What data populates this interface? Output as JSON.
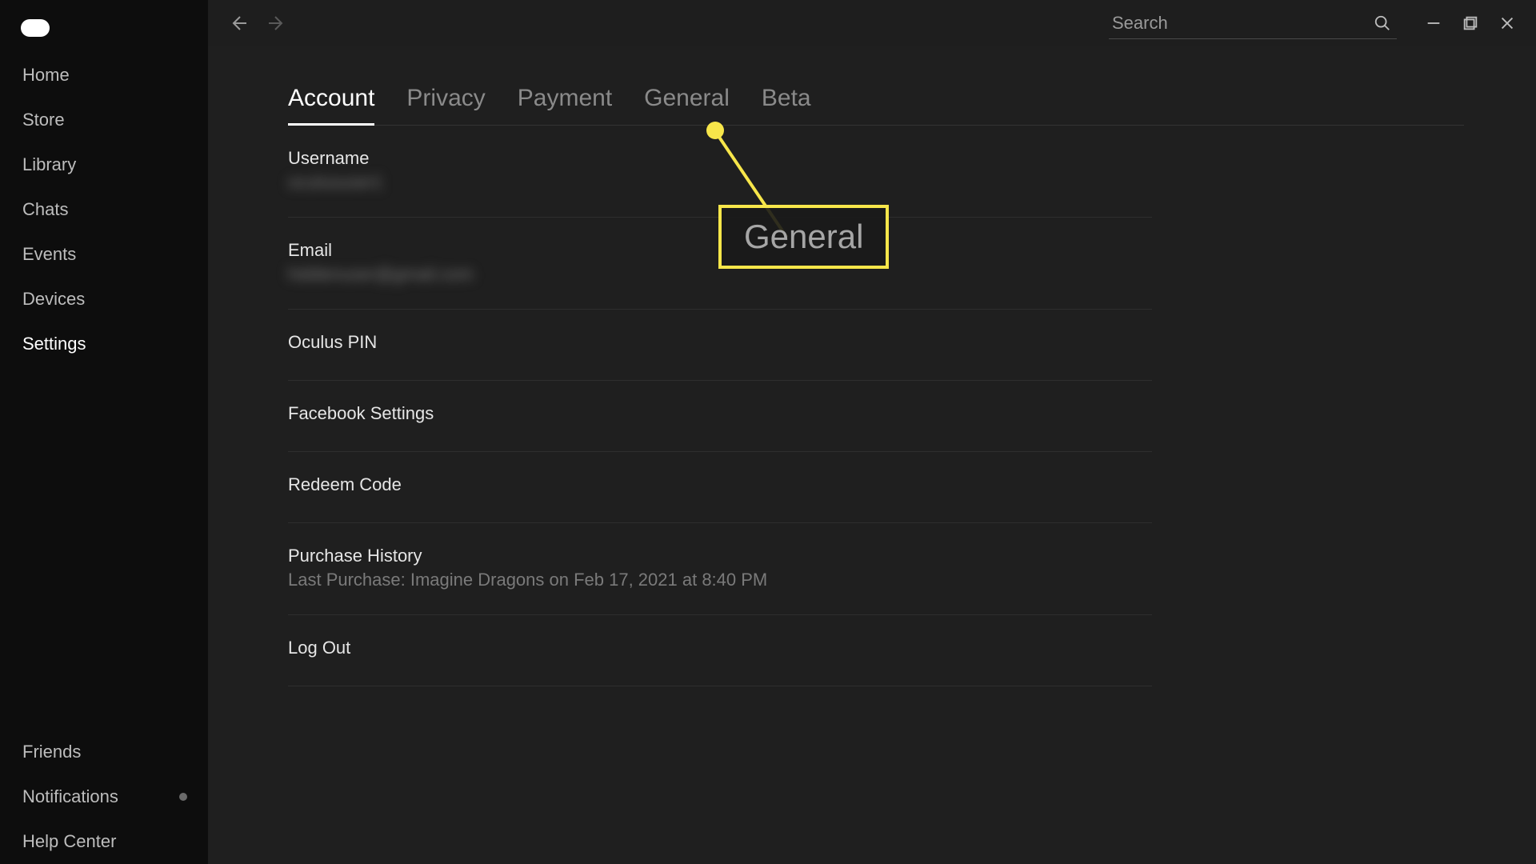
{
  "sidebar": {
    "items": [
      {
        "label": "Home"
      },
      {
        "label": "Store"
      },
      {
        "label": "Library"
      },
      {
        "label": "Chats"
      },
      {
        "label": "Events"
      },
      {
        "label": "Devices"
      },
      {
        "label": "Settings"
      }
    ],
    "bottom": [
      {
        "label": "Friends"
      },
      {
        "label": "Notifications"
      },
      {
        "label": "Help Center"
      }
    ]
  },
  "topbar": {
    "search_placeholder": "Search"
  },
  "tabs": [
    {
      "label": "Account"
    },
    {
      "label": "Privacy"
    },
    {
      "label": "Payment"
    },
    {
      "label": "General"
    },
    {
      "label": "Beta"
    }
  ],
  "account": {
    "username_label": "Username",
    "username_value": "oculususer1",
    "email_label": "Email",
    "email_value": "hiddenuser@gmail.com",
    "pin_label": "Oculus PIN",
    "facebook_label": "Facebook Settings",
    "redeem_label": "Redeem Code",
    "purchase_label": "Purchase History",
    "purchase_value": "Last Purchase: Imagine Dragons on Feb 17, 2021 at 8:40 PM",
    "logout_label": "Log Out"
  },
  "annotation": {
    "text": "General"
  }
}
